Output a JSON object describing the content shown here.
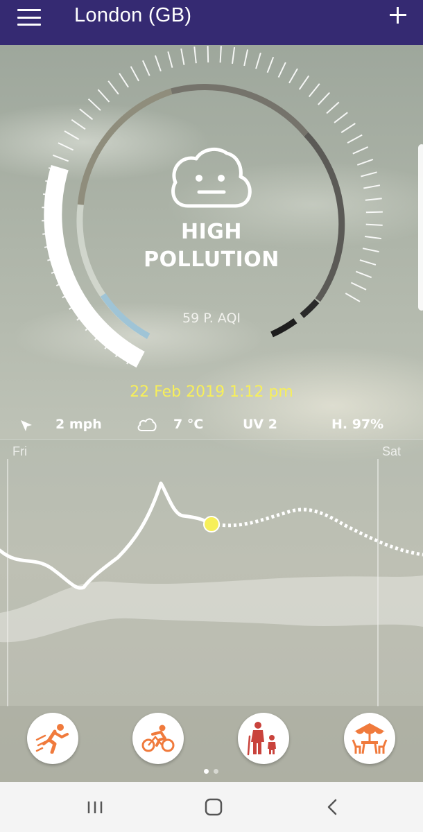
{
  "header": {
    "city": "London (GB)",
    "menu_icon": "hamburger-menu-icon",
    "add_icon": "plus-icon",
    "background_color": "#352a72"
  },
  "gauge": {
    "status_line1": "HIGH",
    "status_line2": "POLLUTION",
    "aqi_text": "59 P. AQI",
    "face_icon": "neutral-cloud-face-icon"
  },
  "datetime": "22 Feb 2019 1:12 pm",
  "conditions": {
    "wind": "2 mph",
    "wind_icon": "wind-direction-arrow-icon",
    "temperature": "7 °C",
    "temperature_icon": "cloud-icon",
    "uv": "UV 2",
    "humidity": "H. 97%"
  },
  "forecast_chart": {
    "day_start": "Fri",
    "day_end": "Sat",
    "current_marker_color": "#f7ef5a"
  },
  "activities": [
    {
      "name": "running",
      "icon": "running-person-icon"
    },
    {
      "name": "cycling",
      "icon": "cyclist-icon"
    },
    {
      "name": "elderly-child",
      "icon": "elderly-and-child-icon"
    },
    {
      "name": "outdoor-dining",
      "icon": "outdoor-table-umbrella-icon"
    }
  ],
  "activity_color": "#f07a3c",
  "pager": {
    "pages": 2,
    "active": 1
  },
  "system_nav": {
    "recents_icon": "recent-apps-icon",
    "home_icon": "home-icon",
    "back_icon": "back-icon"
  }
}
